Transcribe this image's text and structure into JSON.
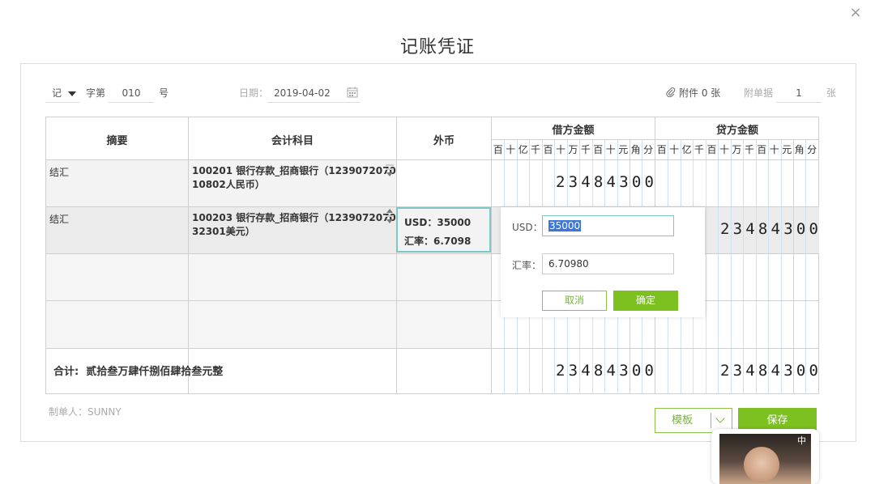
{
  "dialog": {
    "title": "记账凭证",
    "close_icon": "×"
  },
  "voucher_meta": {
    "type_value": "记",
    "zi_label": "字第",
    "number": "010",
    "hao_label": "号",
    "date_label": "日期：",
    "date_value": "2019-04-02",
    "attachment_label": "附件 0 张",
    "attach_docs_label": "附单据",
    "attach_docs_value": "1",
    "zhang_label": "张"
  },
  "table": {
    "headers": {
      "summary": "摘要",
      "account": "会计科目",
      "foreign": "外币",
      "debit": "借方金额",
      "credit": "贷方金额"
    },
    "debit_units": [
      "百",
      "十",
      "亿",
      "千",
      "百",
      "十",
      "万",
      "千",
      "百",
      "十",
      "元",
      "角",
      "分"
    ],
    "credit_units": [
      "百",
      "十",
      "亿",
      "千",
      "百",
      "十",
      "万",
      "千",
      "百",
      "十",
      "元",
      "角",
      "分"
    ],
    "rows": [
      {
        "summary": "结汇",
        "account_line1": "100201 银行存款_招商银行（1239072070",
        "account_line2": "10802人民币）",
        "debit": "2348430 0",
        "credit": ""
      },
      {
        "summary": "结汇",
        "account_line1": "100203 银行存款_招商银行（1239072070",
        "account_line2": "32301美元）",
        "debit": "",
        "credit": "2348430 0",
        "fx_currency": "USD：35000",
        "fx_rate": "汇率：6.7098"
      }
    ],
    "total_label": "合计:",
    "total_words": "贰拾叁万肆仟捌佰肆拾叁元整",
    "total_debit": "23484300",
    "total_credit": "23484300"
  },
  "amounts": {
    "row1_debit": "23484300",
    "row2_credit": "23484300"
  },
  "popup": {
    "usd_label": "USD：",
    "usd_value": "35000",
    "rate_label": "汇率：",
    "rate_value": "6.70980",
    "cancel": "取消",
    "confirm": "确定"
  },
  "footer": {
    "maker": "制单人：SUNNY",
    "template_button": "模板",
    "save_button": "保存"
  },
  "video": {
    "badge": "中"
  },
  "colors": {
    "accent_green": "#7cc11f",
    "focus_teal": "#7cc8c8",
    "grid_blue": "#cde3f3",
    "grid_red": "#f1c5c5"
  }
}
